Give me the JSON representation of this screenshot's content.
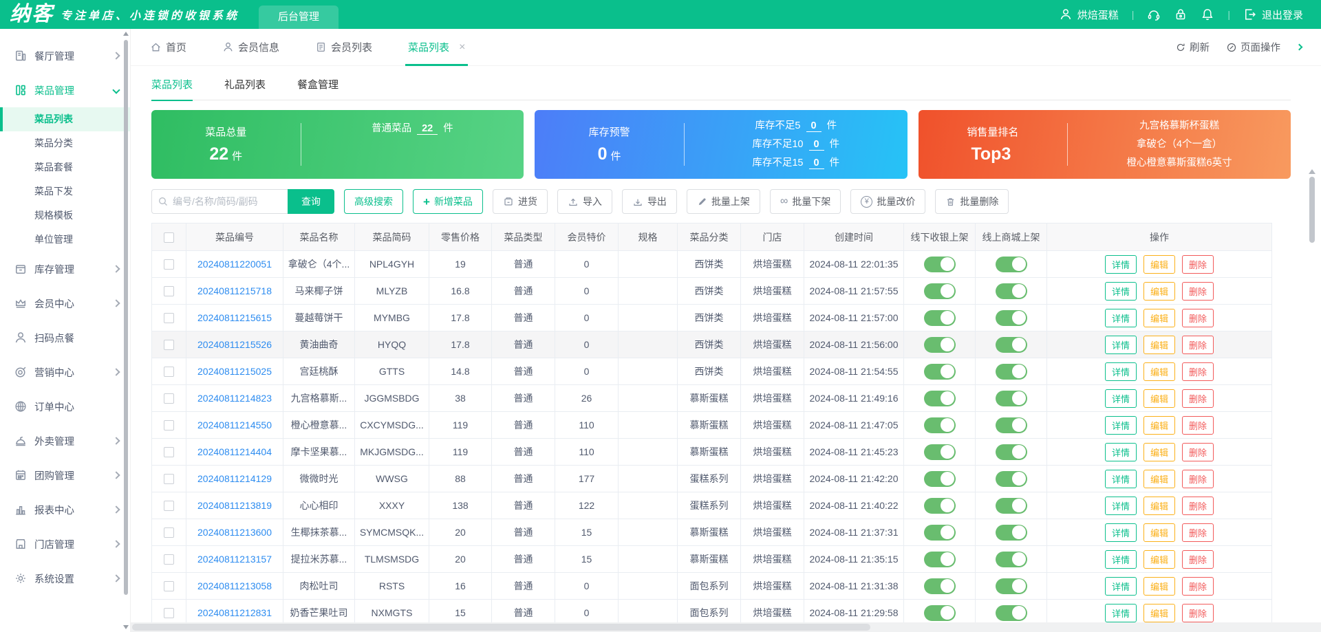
{
  "header": {
    "logo": "纳客",
    "tagline": "专注单店、小连锁的收银系统",
    "nav_tab": "后台管理",
    "user": "烘焙蛋糕",
    "logout": "退出登录"
  },
  "sidebar": {
    "items": [
      {
        "key": "restaurant",
        "icon": "restaurant",
        "label": "餐厅管理",
        "chevron": "right"
      },
      {
        "key": "dish",
        "icon": "dish",
        "label": "菜品管理",
        "chevron": "down",
        "active": true,
        "children": [
          {
            "key": "dish-list",
            "label": "菜品列表",
            "active": true
          },
          {
            "key": "dish-category",
            "label": "菜品分类"
          },
          {
            "key": "dish-combo",
            "label": "菜品套餐"
          },
          {
            "key": "dish-dispatch",
            "label": "菜品下发"
          },
          {
            "key": "spec-template",
            "label": "规格模板"
          },
          {
            "key": "unit-manage",
            "label": "单位管理"
          }
        ]
      },
      {
        "key": "stock",
        "icon": "stock",
        "label": "库存管理",
        "chevron": "right"
      },
      {
        "key": "member",
        "icon": "crown",
        "label": "会员中心",
        "chevron": "right"
      },
      {
        "key": "scan-order",
        "icon": "person",
        "label": "扫码点餐"
      },
      {
        "key": "marketing",
        "icon": "target",
        "label": "营销中心",
        "chevron": "right"
      },
      {
        "key": "order",
        "icon": "globe",
        "label": "订单中心"
      },
      {
        "key": "takeout",
        "icon": "cloche",
        "label": "外卖管理",
        "chevron": "right"
      },
      {
        "key": "groupbuy",
        "icon": "calendar",
        "label": "团购管理",
        "chevron": "right"
      },
      {
        "key": "report",
        "icon": "chart",
        "label": "报表中心",
        "chevron": "right"
      },
      {
        "key": "store",
        "icon": "shop",
        "label": "门店管理",
        "chevron": "right"
      },
      {
        "key": "settings",
        "icon": "gear",
        "label": "系统设置",
        "chevron": "right"
      }
    ]
  },
  "tabbar": {
    "tabs": [
      {
        "label": "首页",
        "icon": "home"
      },
      {
        "label": "会员信息",
        "icon": "person"
      },
      {
        "label": "会员列表",
        "icon": "doc"
      },
      {
        "label": "菜品列表",
        "icon": null,
        "active": true,
        "closable": true
      }
    ],
    "refresh_label": "刷新",
    "page_ops_label": "页面操作"
  },
  "inner_tabs": {
    "tabs": [
      "菜品列表",
      "礼品列表",
      "餐盒管理"
    ],
    "active_index": 0
  },
  "cards": {
    "total": {
      "title": "菜品总量",
      "value": "22",
      "unit": "件",
      "right_label": "普通菜品",
      "right_value": "22",
      "right_unit": "件"
    },
    "stock": {
      "title": "库存预警",
      "value": "0",
      "unit": "件",
      "rows": [
        {
          "label": "库存不足5",
          "value": "0",
          "unit": "件"
        },
        {
          "label": "库存不足10",
          "value": "0",
          "unit": "件"
        },
        {
          "label": "库存不足15",
          "value": "0",
          "unit": "件"
        }
      ]
    },
    "sales": {
      "title": "销售量排名",
      "value": "Top3",
      "items": [
        "九宫格慕斯杯蛋糕",
        "拿破仑（4个一盒）",
        "橙心橙意慕斯蛋糕6英寸"
      ]
    }
  },
  "toolbar": {
    "search_placeholder": "编号/名称/简码/副码",
    "search_button": "查询",
    "advanced_search": "高级搜索",
    "add_item": "新增菜品",
    "purchase": "进货",
    "import": "导入",
    "export": "导出",
    "batch_on": "批量上架",
    "batch_off": "批量下架",
    "batch_price": "批量改价",
    "batch_delete": "批量删除"
  },
  "table": {
    "headers": [
      "",
      "菜品编号",
      "菜品名称",
      "菜品简码",
      "零售价格",
      "菜品类型",
      "会员特价",
      "规格",
      "菜品分类",
      "门店",
      "创建时间",
      "线下收银上架",
      "线上商城上架",
      "操作"
    ],
    "action_labels": [
      "详情",
      "编辑",
      "删除"
    ],
    "rows": [
      {
        "code": "20240811220051",
        "name": "拿破仑（4个...",
        "short_code": "NPL4GYH",
        "price": "19",
        "type": "普通",
        "vip_price": "0",
        "spec": "",
        "category": "西饼类",
        "store": "烘培蛋糕",
        "created_at": "2024-08-11 22:01:35",
        "pos_on": true,
        "mall_on": true
      },
      {
        "code": "20240811215718",
        "name": "马来椰子饼",
        "short_code": "MLYZB",
        "price": "16.8",
        "type": "普通",
        "vip_price": "0",
        "spec": "",
        "category": "西饼类",
        "store": "烘培蛋糕",
        "created_at": "2024-08-11 21:57:55",
        "pos_on": true,
        "mall_on": true
      },
      {
        "code": "20240811215615",
        "name": "蔓越莓饼干",
        "short_code": "MYMBG",
        "price": "17.8",
        "type": "普通",
        "vip_price": "0",
        "spec": "",
        "category": "西饼类",
        "store": "烘培蛋糕",
        "created_at": "2024-08-11 21:57:00",
        "pos_on": true,
        "mall_on": true
      },
      {
        "code": "20240811215526",
        "name": "黄油曲奇",
        "short_code": "HYQQ",
        "price": "17.8",
        "type": "普通",
        "vip_price": "0",
        "spec": "",
        "category": "西饼类",
        "store": "烘培蛋糕",
        "created_at": "2024-08-11 21:56:00",
        "pos_on": true,
        "mall_on": true,
        "shaded": true
      },
      {
        "code": "20240811215025",
        "name": "宫廷桃酥",
        "short_code": "GTTS",
        "price": "14.8",
        "type": "普通",
        "vip_price": "0",
        "spec": "",
        "category": "西饼类",
        "store": "烘培蛋糕",
        "created_at": "2024-08-11 21:54:55",
        "pos_on": true,
        "mall_on": true
      },
      {
        "code": "20240811214823",
        "name": "九宫格慕斯...",
        "short_code": "JGGMSBDG",
        "price": "38",
        "type": "普通",
        "vip_price": "26",
        "spec": "",
        "category": "慕斯蛋糕",
        "store": "烘培蛋糕",
        "created_at": "2024-08-11 21:49:16",
        "pos_on": true,
        "mall_on": true
      },
      {
        "code": "20240811214550",
        "name": "橙心橙意慕...",
        "short_code": "CXCYMSDG...",
        "price": "119",
        "type": "普通",
        "vip_price": "110",
        "spec": "",
        "category": "慕斯蛋糕",
        "store": "烘培蛋糕",
        "created_at": "2024-08-11 21:47:05",
        "pos_on": true,
        "mall_on": true
      },
      {
        "code": "20240811214404",
        "name": "摩卡坚果慕...",
        "short_code": "MKJGMSDG...",
        "price": "119",
        "type": "普通",
        "vip_price": "110",
        "spec": "",
        "category": "慕斯蛋糕",
        "store": "烘培蛋糕",
        "created_at": "2024-08-11 21:45:23",
        "pos_on": true,
        "mall_on": true
      },
      {
        "code": "20240811214129",
        "name": "微微时光",
        "short_code": "WWSG",
        "price": "88",
        "type": "普通",
        "vip_price": "177",
        "spec": "",
        "category": "蛋糕系列",
        "store": "烘培蛋糕",
        "created_at": "2024-08-11 21:42:20",
        "pos_on": true,
        "mall_on": true
      },
      {
        "code": "20240811213819",
        "name": "心心相印",
        "short_code": "XXXY",
        "price": "138",
        "type": "普通",
        "vip_price": "122",
        "spec": "",
        "category": "蛋糕系列",
        "store": "烘培蛋糕",
        "created_at": "2024-08-11 21:40:22",
        "pos_on": true,
        "mall_on": true
      },
      {
        "code": "20240811213600",
        "name": "生椰抹茶慕...",
        "short_code": "SYMCMSQK...",
        "price": "20",
        "type": "普通",
        "vip_price": "15",
        "spec": "",
        "category": "慕斯蛋糕",
        "store": "烘培蛋糕",
        "created_at": "2024-08-11 21:37:31",
        "pos_on": true,
        "mall_on": true
      },
      {
        "code": "20240811213157",
        "name": "提拉米苏慕...",
        "short_code": "TLMSMSDG",
        "price": "20",
        "type": "普通",
        "vip_price": "15",
        "spec": "",
        "category": "慕斯蛋糕",
        "store": "烘培蛋糕",
        "created_at": "2024-08-11 21:35:15",
        "pos_on": true,
        "mall_on": true
      },
      {
        "code": "20240811213058",
        "name": "肉松吐司",
        "short_code": "RSTS",
        "price": "16",
        "type": "普通",
        "vip_price": "0",
        "spec": "",
        "category": "面包系列",
        "store": "烘培蛋糕",
        "created_at": "2024-08-11 21:31:38",
        "pos_on": true,
        "mall_on": true
      },
      {
        "code": "20240811212831",
        "name": "奶香芒果吐司",
        "short_code": "NXMGTS",
        "price": "15",
        "type": "普通",
        "vip_price": "0",
        "spec": "",
        "category": "面包系列",
        "store": "烘培蛋糕",
        "created_at": "2024-08-11 21:29:58",
        "pos_on": true,
        "mall_on": true
      }
    ]
  },
  "colors": {
    "brand_green": "#0abf8c",
    "card_green_from": "#2fbd62",
    "card_green_to": "#57d385",
    "card_blue_from": "#4d7df8",
    "card_blue_to": "#26c3f6",
    "card_orange_from": "#f0512b",
    "card_orange_to": "#f89a5f",
    "link_blue": "#2d8cf0",
    "toggle_green": "#69bd6f",
    "edit_yellow": "#fbb019",
    "delete_red": "#f25a5a"
  }
}
